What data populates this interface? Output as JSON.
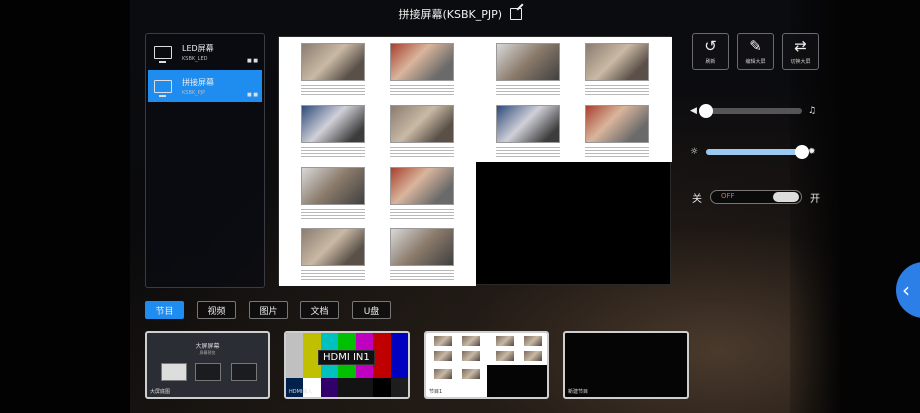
{
  "window": {
    "title": "拼接屏幕(KSBK_PJP)"
  },
  "screens": [
    {
      "name": "LED屏幕",
      "sub": "KSBK_LED",
      "active": false,
      "dots": "■ ■"
    },
    {
      "name": "拼接屏幕",
      "sub": "KSBK_PJP",
      "active": true,
      "dots": "■ ■"
    }
  ],
  "tools": [
    {
      "icon": "↺",
      "label": "刷新"
    },
    {
      "icon": "✎",
      "label": "编辑大屏"
    },
    {
      "icon": "⇄",
      "label": "切换大屏"
    }
  ],
  "volume": {
    "level": 0.0,
    "icon_left": "◀",
    "icon_right": "♫"
  },
  "brightness": {
    "level": 1.0,
    "icon_left": "☼",
    "icon_right": "✹"
  },
  "power": {
    "off_label": "关",
    "on_label": "开",
    "state_text": "OFF"
  },
  "tabs": [
    {
      "label": "节目",
      "active": true
    },
    {
      "label": "视频",
      "active": false
    },
    {
      "label": "图片",
      "active": false
    },
    {
      "label": "文档",
      "active": false
    },
    {
      "label": "U盘",
      "active": false
    }
  ],
  "thumbnails": [
    {
      "label": "大屏底图",
      "heading": "大屏屏幕",
      "subheading": "屏幕预览"
    },
    {
      "label": "HDMI输入",
      "overlay": "HDMI IN1"
    },
    {
      "label": "节目1"
    },
    {
      "label": "新建节目"
    }
  ],
  "colors": {
    "accent": "#1f8cf0",
    "off_red": "#ff5a4a"
  }
}
